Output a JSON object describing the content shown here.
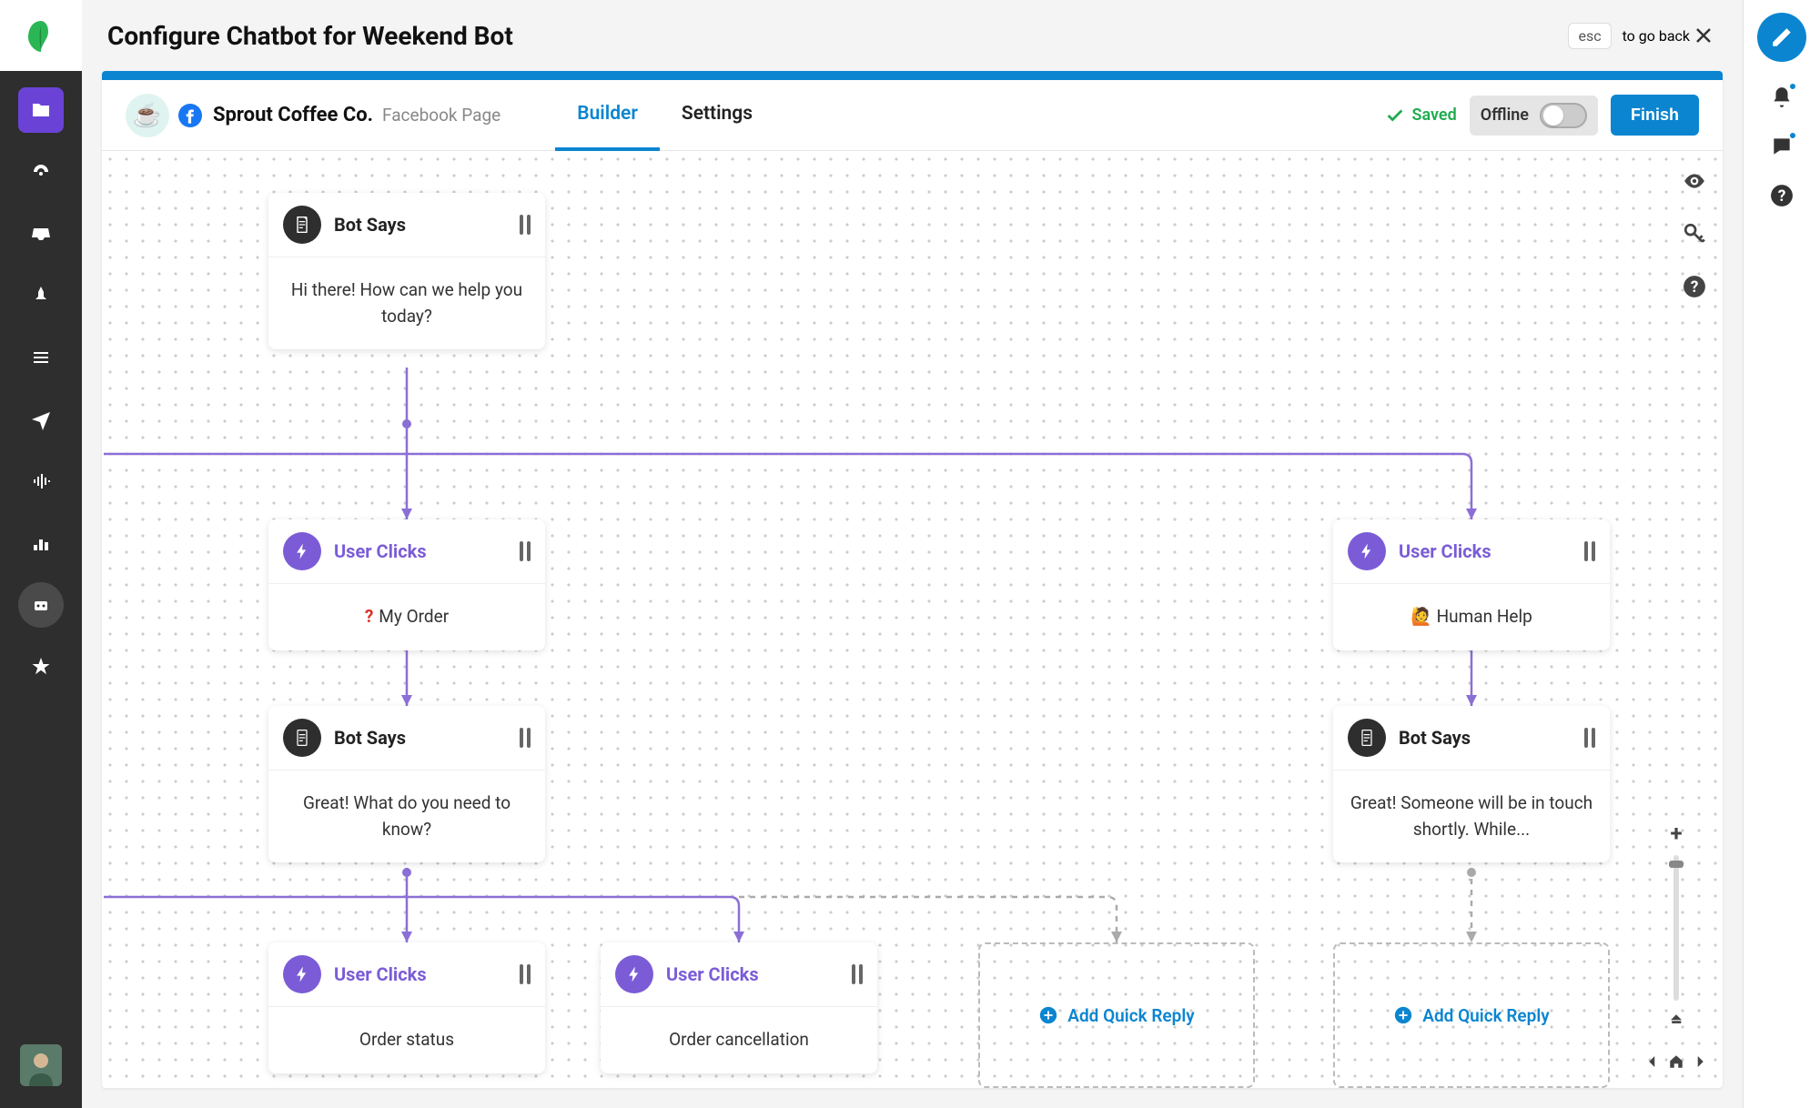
{
  "header": {
    "title": "Configure Chatbot for Weekend Bot",
    "esc": "esc",
    "goback": "to go back"
  },
  "profile": {
    "company": "Sprout Coffee Co.",
    "pageType": "Facebook Page"
  },
  "tabs": {
    "builder": "Builder",
    "settings": "Settings"
  },
  "status": {
    "saved": "Saved",
    "offline": "Offline",
    "finish": "Finish"
  },
  "nodes": {
    "botSays1": {
      "title": "Bot Says",
      "body": "Hi there! How can we help you today?"
    },
    "userClicks1": {
      "title": "User Clicks",
      "body": "My Order"
    },
    "userClicks2": {
      "title": "User Clicks",
      "body": "Human Help"
    },
    "botSays2": {
      "title": "Bot Says",
      "body": "Great! What do you need to know?"
    },
    "botSays3": {
      "title": "Bot Says",
      "body": "Great! Someone will be in touch shortly. While..."
    },
    "userClicks3": {
      "title": "User Clicks",
      "body": "Order status"
    },
    "userClicks4": {
      "title": "User Clicks",
      "body": "Order cancellation"
    },
    "addQuickReply": "Add Quick Reply"
  }
}
